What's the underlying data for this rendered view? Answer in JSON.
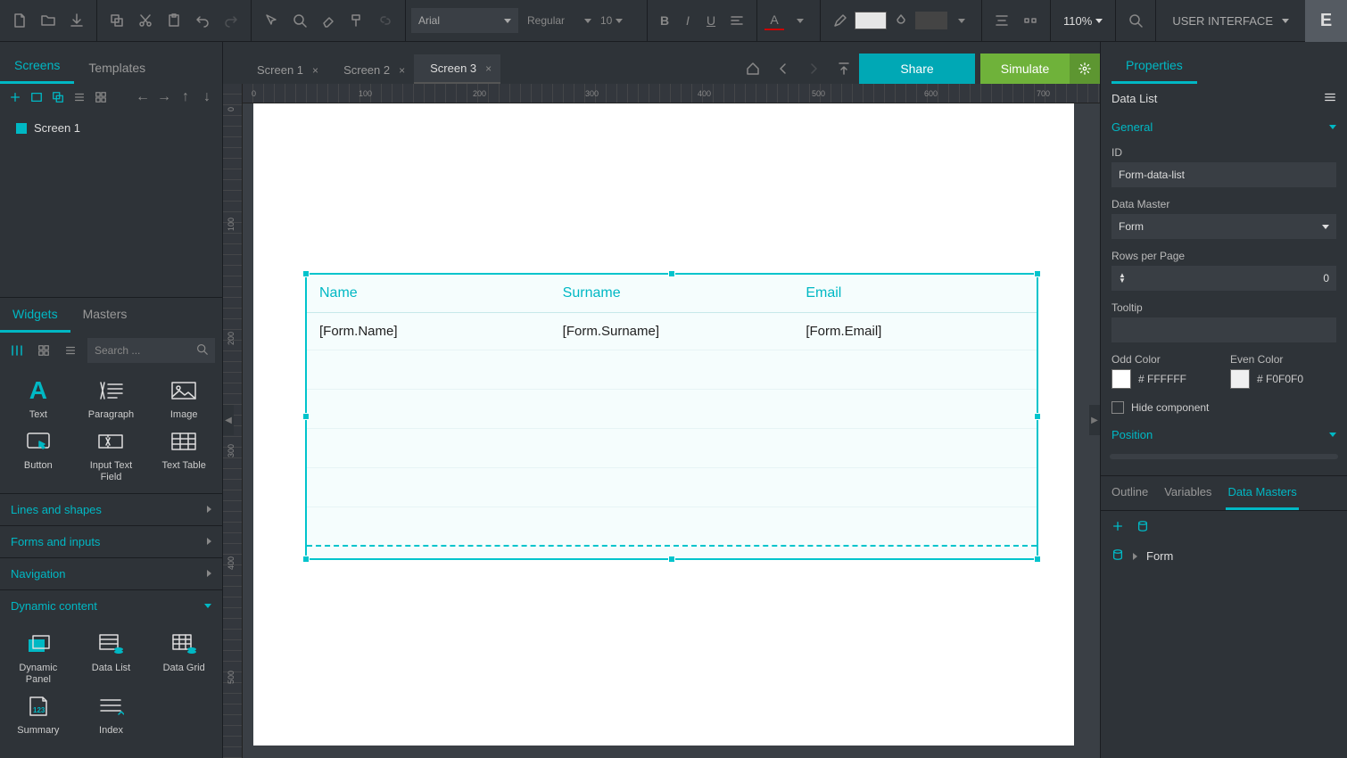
{
  "toolbar": {
    "font": "Arial",
    "font_weight": "Regular",
    "font_size": "10",
    "zoom": "110%",
    "user_label": "USER INTERFACE",
    "logo": "E"
  },
  "left_tabs": {
    "screens": "Screens",
    "templates": "Templates"
  },
  "screen_tabs": [
    {
      "label": "Screen 1",
      "active": false
    },
    {
      "label": "Screen 2",
      "active": false
    },
    {
      "label": "Screen 3",
      "active": true
    }
  ],
  "actions": {
    "share": "Share",
    "simulate": "Simulate"
  },
  "right_tabs": {
    "properties": "Properties"
  },
  "screens_list": [
    {
      "label": "Screen 1"
    }
  ],
  "widgets_tabs": {
    "widgets": "Widgets",
    "masters": "Masters"
  },
  "widgets_search_placeholder": "Search ...",
  "widgets_basic": [
    {
      "name": "text",
      "label": "Text"
    },
    {
      "name": "paragraph",
      "label": "Paragraph"
    },
    {
      "name": "image",
      "label": "Image"
    },
    {
      "name": "button",
      "label": "Button"
    },
    {
      "name": "input-text-field",
      "label": "Input Text Field"
    },
    {
      "name": "text-table",
      "label": "Text Table"
    }
  ],
  "widget_categories": [
    {
      "label": "Lines and shapes",
      "open": false
    },
    {
      "label": "Forms and inputs",
      "open": false
    },
    {
      "label": "Navigation",
      "open": false
    },
    {
      "label": "Dynamic content",
      "open": true
    }
  ],
  "widgets_dynamic": [
    {
      "name": "dynamic-panel",
      "label": "Dynamic Panel"
    },
    {
      "name": "data-list",
      "label": "Data List"
    },
    {
      "name": "data-grid",
      "label": "Data Grid"
    },
    {
      "name": "summary",
      "label": "Summary"
    },
    {
      "name": "index",
      "label": "Index"
    }
  ],
  "ruler_h": [
    "0",
    "100",
    "200",
    "300",
    "400",
    "500",
    "600",
    "700"
  ],
  "ruler_v": [
    "0",
    "100",
    "200",
    "300",
    "400",
    "500"
  ],
  "canvas": {
    "headers": [
      "Name",
      "Surname",
      "Email"
    ],
    "row": [
      "[Form.Name]",
      "[Form.Surname]",
      "[Form.Email]"
    ]
  },
  "properties": {
    "header": "Data List",
    "section_general": "General",
    "id_label": "ID",
    "id_value": "Form-data-list",
    "data_master_label": "Data Master",
    "data_master_value": "Form",
    "rows_per_page_label": "Rows per Page",
    "rows_per_page_value": "0",
    "tooltip_label": "Tooltip",
    "tooltip_value": "",
    "odd_color_label": "Odd Color",
    "odd_color_value": "# FFFFFF",
    "even_color_label": "Even Color",
    "even_color_value": "# F0F0F0",
    "hide_label": "Hide component",
    "section_position": "Position"
  },
  "dm_tabs": {
    "outline": "Outline",
    "variables": "Variables",
    "data_masters": "Data Masters"
  },
  "dm_items": [
    {
      "label": "Form"
    }
  ]
}
